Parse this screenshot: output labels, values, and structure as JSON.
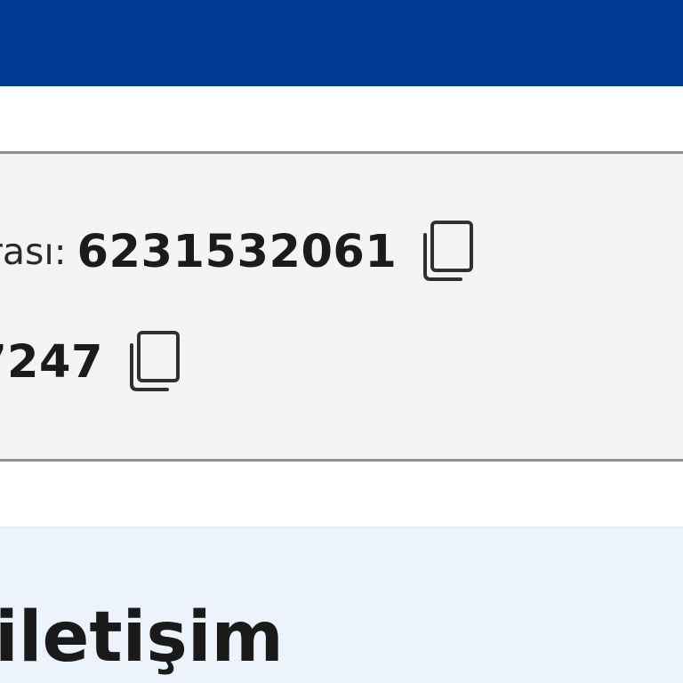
{
  "header": {
    "bar_color": "#003a96"
  },
  "info_panel": {
    "rows": [
      {
        "label": "rası:",
        "value": "6231532061",
        "copy_icon": "copy-icon"
      },
      {
        "label": "",
        "value": "7247",
        "copy_icon": "copy-icon"
      }
    ]
  },
  "contact_section": {
    "title": "iletişim"
  }
}
